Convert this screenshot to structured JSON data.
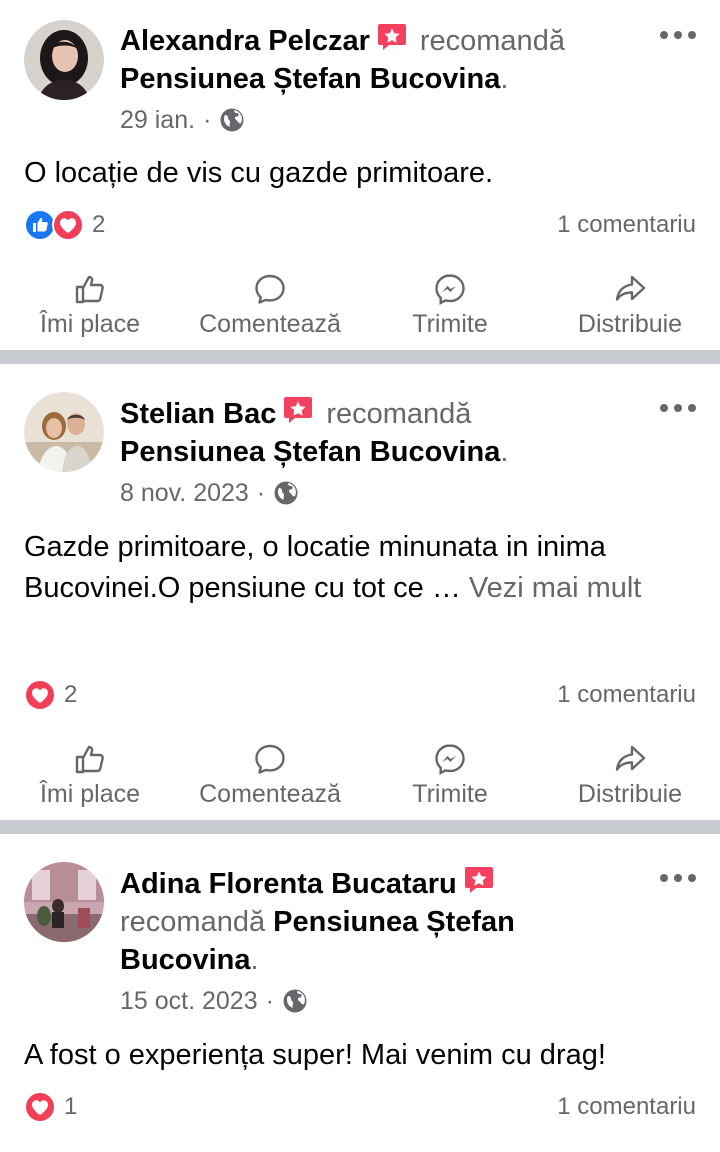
{
  "posts": [
    {
      "author": "Alexandra Pelczar",
      "recommends_word": "recomandă",
      "page_name": "Pensiunea Ștefan Bucovina",
      "period": ".",
      "date": "29 ian.",
      "meta_sep": "·",
      "text": "O locație de vis cu gazde primitoare.",
      "see_more": "",
      "reaction_count": "2",
      "reactions": [
        "like-icon",
        "love-icon"
      ],
      "comments": "1 comentariu"
    },
    {
      "author": "Stelian Bac",
      "recommends_word": "recomandă",
      "page_name": "Pensiunea Ștefan Bucovina",
      "period": ".",
      "date": "8 nov. 2023",
      "meta_sep": "·",
      "text_line1": "Gazde primitoare, o locatie minunata  in inima",
      "text_line2": "Bucovinei.O pensiune cu tot ce … ",
      "see_more": "Vezi mai mult",
      "reaction_count": "2",
      "reactions": [
        "love-icon"
      ],
      "comments": "1 comentariu"
    },
    {
      "author": "Adina Florenta Bucataru",
      "recommends_word": "recomandă",
      "page_name_line1": "Pensiunea Ștefan",
      "page_name_line2": "Bucovina",
      "period": ".",
      "date": "15 oct. 2023",
      "meta_sep": "·",
      "text": "A fost o experiența super! Mai venim cu drag!",
      "reaction_count": "1",
      "reactions": [
        "love-icon"
      ],
      "comments": "1 comentariu"
    }
  ],
  "actions": {
    "like": "Îmi place",
    "comment": "Comentează",
    "send": "Trimite",
    "share": "Distribuie"
  },
  "colors": {
    "like_blue": "#1877f2",
    "love_red": "#f33e58",
    "secondary_text": "#65676b",
    "separator": "#c9ccd1",
    "recommend_badge": "#f3425f"
  }
}
